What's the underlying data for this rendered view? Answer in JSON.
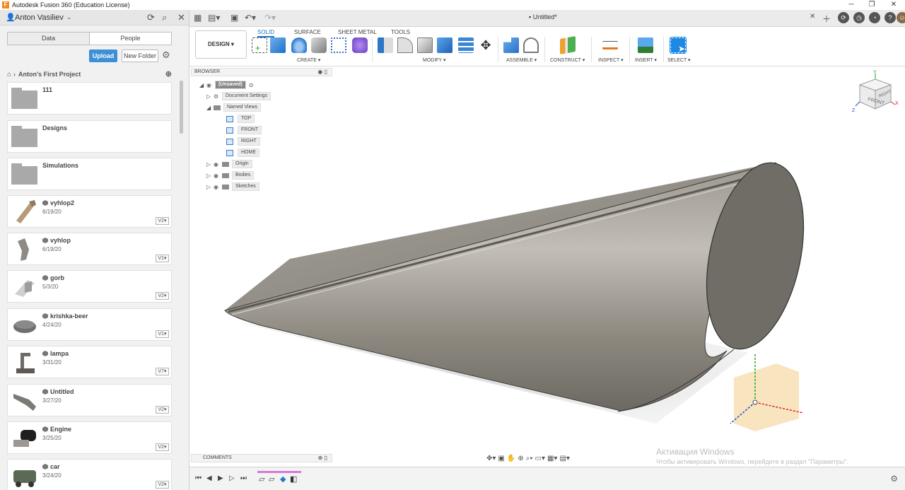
{
  "window": {
    "title": "Autodesk Fusion 360 (Education License)",
    "logo_letter": "F",
    "minimize": "─",
    "maximize": "❐",
    "close": "✕"
  },
  "data_panel": {
    "user": "Anton Vasiliev",
    "tabs": [
      "Data",
      "People"
    ],
    "upload_label": "Upload",
    "new_folder_label": "New Folder",
    "breadcrumb": "Anton's First Project",
    "folders": [
      {
        "name": "111"
      },
      {
        "name": "Designs"
      },
      {
        "name": "Simulations"
      }
    ],
    "designs": [
      {
        "name": "vyhlop2",
        "date": "6/19/20",
        "version": "V2"
      },
      {
        "name": "vyhlop",
        "date": "6/19/20",
        "version": "V1"
      },
      {
        "name": "gorb",
        "date": "5/3/20",
        "version": "V2"
      },
      {
        "name": "krishka-beer",
        "date": "4/24/20",
        "version": "V1"
      },
      {
        "name": "lampa",
        "date": "3/31/20",
        "version": "V7"
      },
      {
        "name": "Untitled",
        "date": "3/27/20",
        "version": "V2"
      },
      {
        "name": "Engine",
        "date": "3/25/20",
        "version": "V2"
      },
      {
        "name": "car",
        "date": "3/24/20",
        "version": "V2"
      }
    ]
  },
  "document": {
    "tab_title": "Untitled*"
  },
  "toolbar": {
    "workspace": "DESIGN ▾",
    "tabs": [
      "SOLID",
      "SURFACE",
      "SHEET METAL",
      "TOOLS"
    ],
    "groups": [
      "CREATE ▾",
      "MODIFY ▾",
      "ASSEMBLE ▾",
      "CONSTRUCT ▾",
      "INSPECT ▾",
      "INSERT ▾",
      "SELECT ▾"
    ]
  },
  "browser": {
    "header": "BROWSER",
    "root": "(Unsaved)",
    "document_settings": "Document Settings",
    "named_views": "Named Views",
    "views": [
      "TOP",
      "FRONT",
      "RIGHT",
      "HOME"
    ],
    "items": [
      "Origin",
      "Bodies",
      "Sketches"
    ]
  },
  "viewcube": {
    "front": "FRONT",
    "right": "RIGHT",
    "axis_x": "X",
    "axis_y": "Y",
    "axis_z": "Z"
  },
  "comments": {
    "header": "COMMENTS"
  },
  "watermark": {
    "line1": "Активация Windows",
    "line2": "Чтобы активировать Windows, перейдите в раздел \"Параметры\"."
  },
  "colors": {
    "accent": "#1e73be",
    "upload": "#3d8fd6",
    "body_surface": "#8f8b84"
  }
}
